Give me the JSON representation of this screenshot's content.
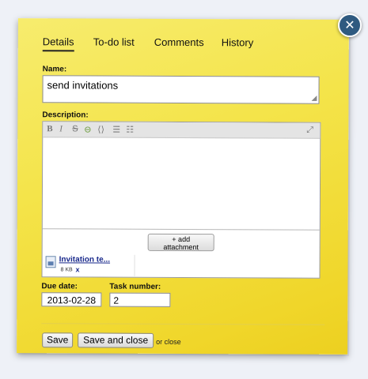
{
  "dialog": {
    "close_icon": "close-icon"
  },
  "tabs": [
    {
      "label": "Details",
      "active": true
    },
    {
      "label": "To-do list",
      "active": false
    },
    {
      "label": "Comments",
      "active": false
    },
    {
      "label": "History",
      "active": false
    }
  ],
  "form": {
    "name_label": "Name:",
    "name_value": "send invitations",
    "description_label": "Description:",
    "description_value": "",
    "toolbar": [
      "bold-icon",
      "italic-icon",
      "strikethrough-icon",
      "link-icon",
      "code-icon",
      "bulleted-list-icon",
      "numbered-list-icon",
      "fullscreen-icon"
    ],
    "add_attachment_label_1": "+ add",
    "add_attachment_label_2": "attachment",
    "attachment": {
      "name": "Invitation te...",
      "size": "8 KB",
      "remove": "x"
    },
    "due_date_label": "Due date:",
    "due_date_value": "2013-02-28",
    "task_number_label": "Task number:",
    "task_number_value": "2"
  },
  "footer": {
    "save_label": "Save",
    "save_close_label": "Save and close",
    "or_text": "or",
    "close_link": "close"
  },
  "colors": {
    "note_yellow": "#f4e44a",
    "close_button": "#2f5a80",
    "link_blue": "#1a2a8c"
  }
}
